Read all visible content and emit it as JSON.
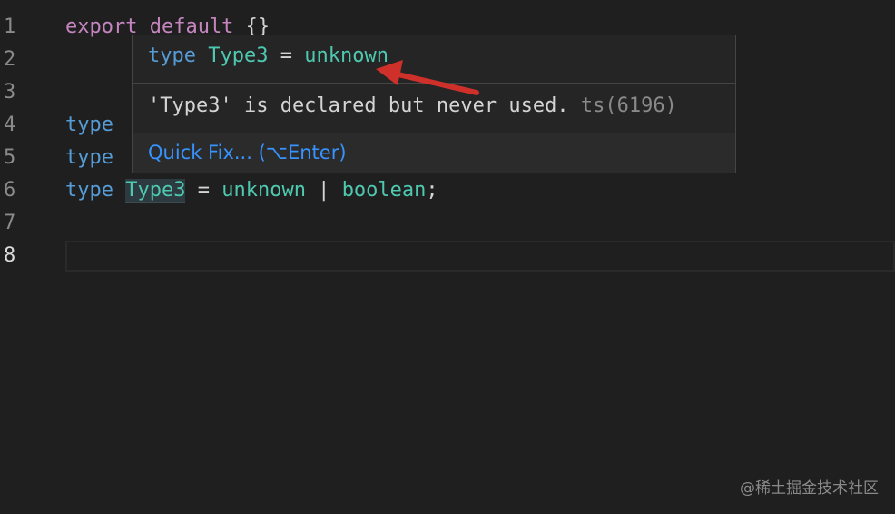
{
  "editor": {
    "top_cut_text": "",
    "line_numbers": [
      "1",
      "2",
      "3",
      "4",
      "5",
      "6",
      "7",
      "8"
    ],
    "line1": {
      "kw": "export default",
      "rest": " {}"
    },
    "line4": {
      "kw": "type"
    },
    "line5": {
      "kw": "type"
    },
    "line6": {
      "kw": "type",
      "name": "Type3",
      "eq": " = ",
      "t1": "unknown",
      "pipe": " | ",
      "t2": "boolean",
      "end": ";"
    }
  },
  "hover": {
    "signature": {
      "kw": "type",
      "name": "Type3",
      "eq": " = ",
      "value": "unknown"
    },
    "message": "'Type3' is declared but never used.",
    "code": "ts(6196)",
    "quick_fix": "Quick Fix... (⌥Enter)"
  },
  "watermark": "@稀土掘金技术社区",
  "colors": {
    "background": "#1f1f1f",
    "keyword": "#569cd6",
    "type": "#4ec9b0",
    "link": "#3794ff",
    "arrow": "#d0302a"
  }
}
